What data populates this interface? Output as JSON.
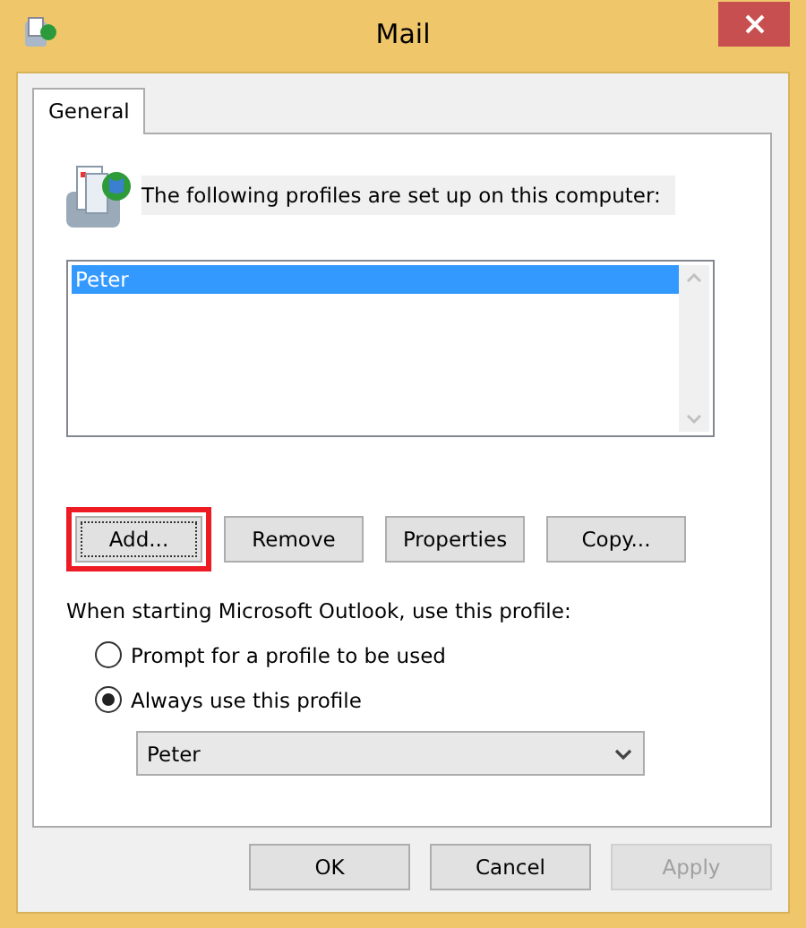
{
  "window": {
    "title": "Mail"
  },
  "tabs": [
    {
      "label": "General",
      "selected": true
    }
  ],
  "heading": "The following profiles are set up on this computer:",
  "profiles": [
    {
      "name": "Peter",
      "selected": true
    }
  ],
  "profile_buttons": [
    {
      "label": "Add...",
      "highlighted": true,
      "focused": true
    },
    {
      "label": "Remove",
      "highlighted": false,
      "focused": false
    },
    {
      "label": "Properties",
      "highlighted": false,
      "focused": false
    },
    {
      "label": "Copy...",
      "highlighted": false,
      "focused": false
    }
  ],
  "startup_label": "When starting Microsoft Outlook, use this profile:",
  "startup_options": [
    {
      "label": "Prompt for a profile to be used",
      "selected": false
    },
    {
      "label": "Always use this profile",
      "selected": true
    }
  ],
  "profile_select": {
    "value": "Peter"
  },
  "dialog_buttons": [
    {
      "label": "OK",
      "disabled": false
    },
    {
      "label": "Cancel",
      "disabled": false
    },
    {
      "label": "Apply",
      "disabled": true
    }
  ]
}
